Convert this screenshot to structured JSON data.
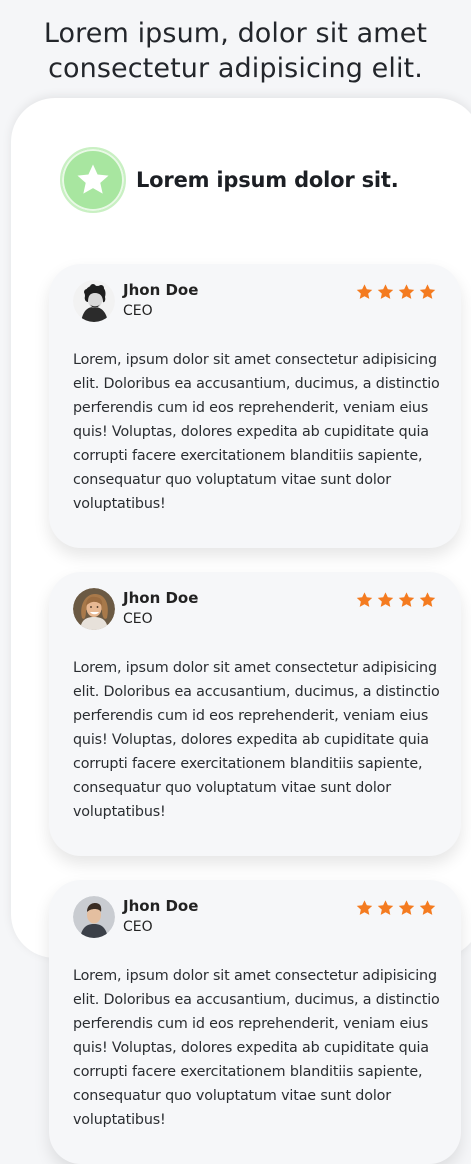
{
  "page": {
    "title_line1": "Lorem ipsum, dolor sit amet",
    "title_line2": "consectetur adipisicing elit."
  },
  "hero": {
    "icon": "star-icon",
    "title": "Lorem ipsum dolor sit.",
    "badge_color": "#a8e6a0"
  },
  "accent_color": "#f47b20",
  "testimonials": [
    {
      "avatar": "avatar-curly-hair-man",
      "name": "Jhon Doe",
      "role": "CEO",
      "rating": 4,
      "text": "Lorem, ipsum dolor sit amet consectetur adipisicing elit. Doloribus ea accusantium, ducimus, a distinctio perferendis cum id eos reprehenderit, veniam eius quis! Voluptas, dolores expedita ab cupiditate quia corrupti facere exercitationem blanditiis sapiente, consequatur quo voluptatum vitae sunt dolor voluptatibus!"
    },
    {
      "avatar": "avatar-smiling-woman",
      "name": "Jhon Doe",
      "role": "CEO",
      "rating": 4,
      "text": "Lorem, ipsum dolor sit amet consectetur adipisicing elit. Doloribus ea accusantium, ducimus, a distinctio perferendis cum id eos reprehenderit, veniam eius quis! Voluptas, dolores expedita ab cupiditate quia corrupti facere exercitationem blanditiis sapiente, consequatur quo voluptatum vitae sunt dolor voluptatibus!"
    },
    {
      "avatar": "avatar-man",
      "name": "Jhon Doe",
      "role": "CEO",
      "rating": 4,
      "text": "Lorem, ipsum dolor sit amet consectetur adipisicing elit. Doloribus ea accusantium, ducimus, a distinctio perferendis cum id eos reprehenderit, veniam eius quis! Voluptas, dolores expedita ab cupiditate quia corrupti facere exercitationem blanditiis sapiente, consequatur quo voluptatum vitae sunt dolor voluptatibus!"
    }
  ]
}
